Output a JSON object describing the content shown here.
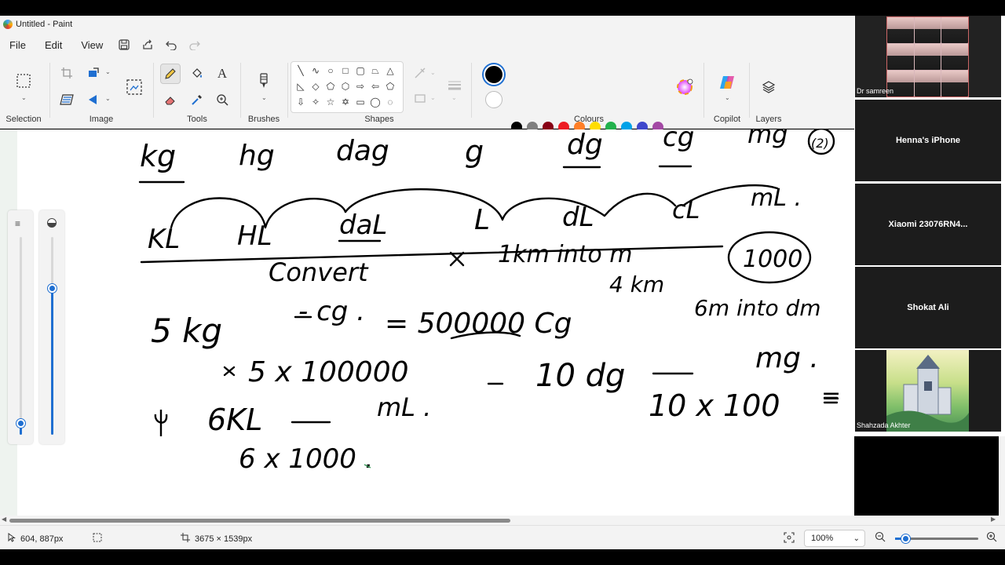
{
  "window": {
    "title": "Untitled - Paint"
  },
  "menu": {
    "items": [
      "File",
      "Edit",
      "View"
    ]
  },
  "ribbon": {
    "groups": {
      "selection": "Selection",
      "image": "Image",
      "tools": "Tools",
      "brushes": "Brushes",
      "shapes": "Shapes",
      "colours": "Colours",
      "copilot": "Copilot",
      "layers": "Layers"
    },
    "current_colors": {
      "primary": "#000000",
      "secondary": "#ffffff"
    },
    "palette_row1": [
      "#000000",
      "#7f7f7f",
      "#880015",
      "#ed1c24",
      "#ff7f27",
      "#ffdd00",
      "#22b14c",
      "#00a2e8",
      "#3f48cc",
      "#a349a4"
    ],
    "palette_row2": [
      "#ffffff",
      "#c3c3c3",
      "#b97a57",
      "#ffaec9",
      "#ffc90e",
      "#efe4b0",
      "#b5e61d",
      "#99d9ea",
      "#7092be",
      "#c8bfe7"
    ]
  },
  "status": {
    "cursor_pos": "604, 887px",
    "canvas_size": "3675 × 1539px",
    "zoom": "100%"
  },
  "participants": [
    {
      "name": "Dr samreen",
      "kind": "video"
    },
    {
      "name": "Henna's iPhone",
      "kind": "audio"
    },
    {
      "name": "Xiaomi  23076RN4...",
      "kind": "audio"
    },
    {
      "name": "Shokat Ali",
      "kind": "audio"
    },
    {
      "name": "Shahzada Akhter",
      "kind": "image"
    }
  ],
  "handwriting": {
    "row1": [
      "kg",
      "hg",
      "dag",
      "g",
      "dg",
      "cg",
      "mg",
      "(2)"
    ],
    "row2": [
      "KL",
      "HL",
      "daL",
      "L",
      "dL",
      "cL",
      "mL ."
    ],
    "convert_line": [
      "Convert",
      "1km  into  m",
      "1000",
      "4 km",
      "6m  into  dm"
    ],
    "problem1": [
      "5 kg",
      "- cg .",
      "= 500000 Cg",
      "5 x 100000"
    ],
    "problem2": [
      "10 dg",
      "mg .",
      "10 x 100",
      "="
    ],
    "problem3": [
      "6KL",
      "mL .",
      "6 x 1000 ."
    ]
  }
}
